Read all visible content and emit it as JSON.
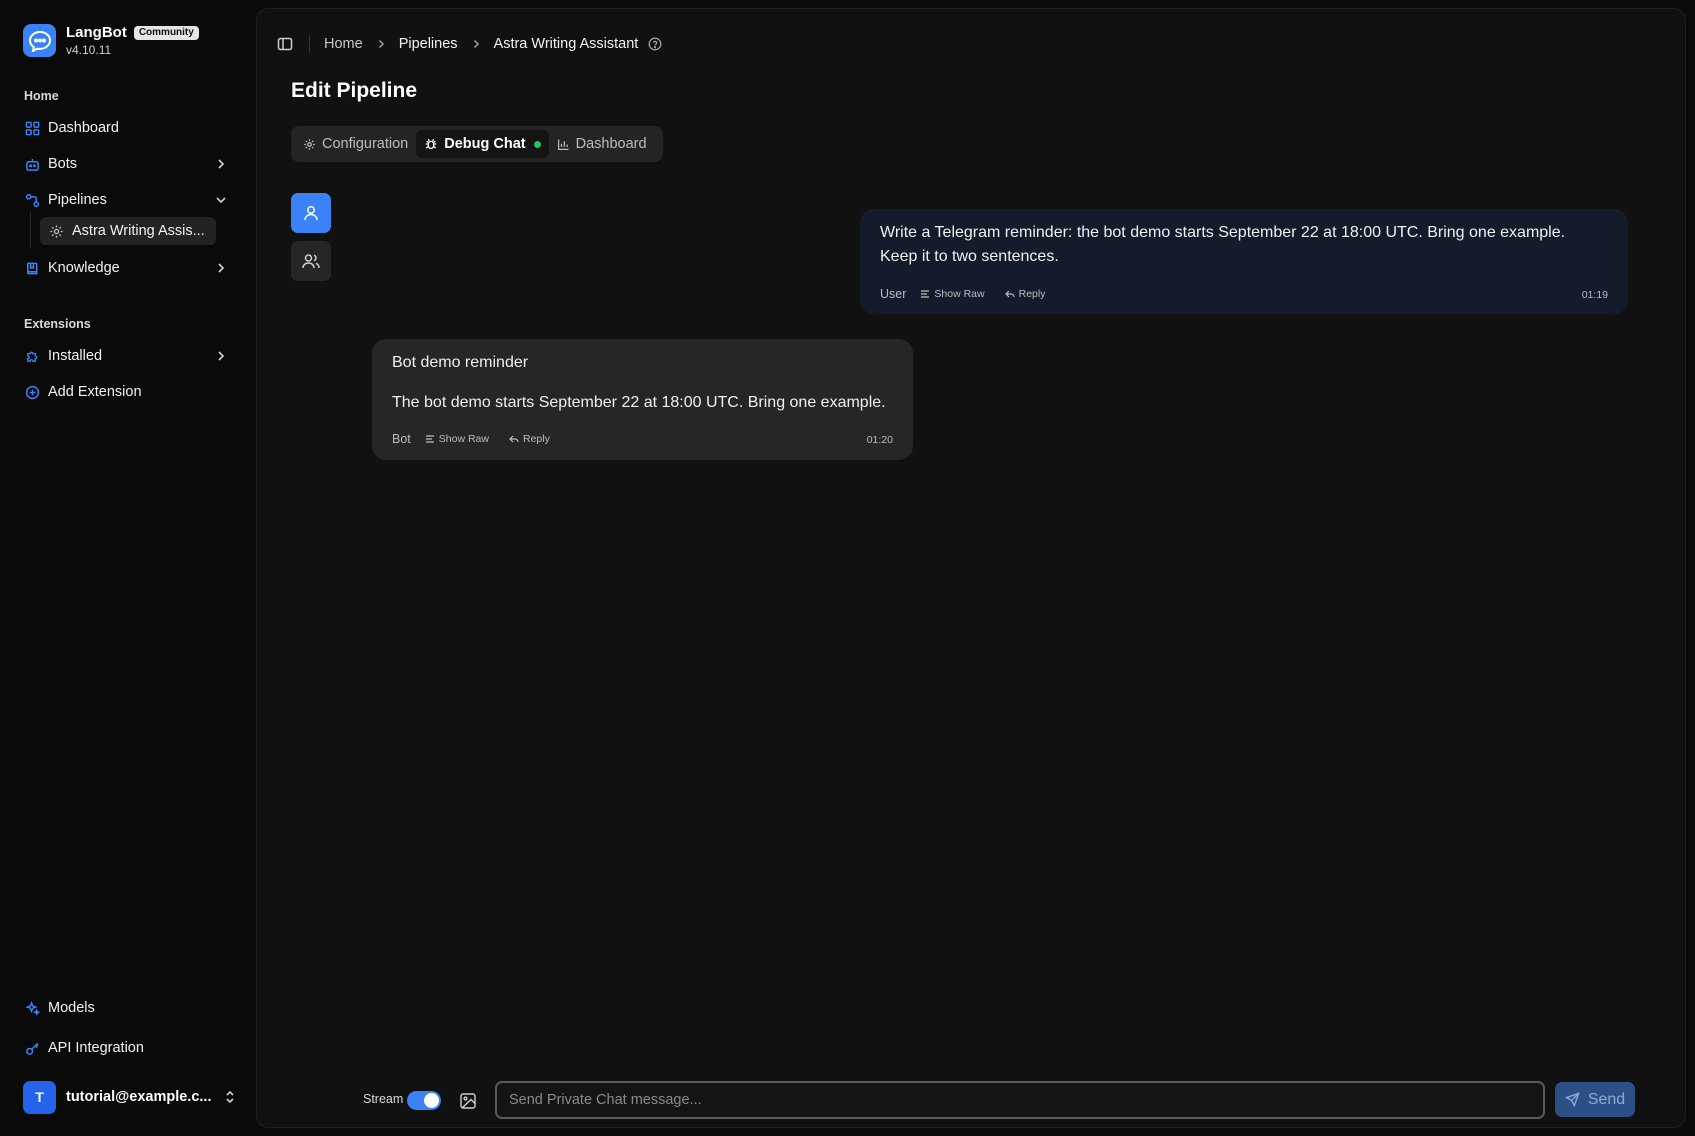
{
  "brand": {
    "name": "LangBot",
    "badge": "Community",
    "version": "v4.10.11"
  },
  "sidebar": {
    "section_home": "Home",
    "section_extensions": "Extensions",
    "items": {
      "dashboard": "Dashboard",
      "bots": "Bots",
      "pipelines": "Pipelines",
      "pipeline_sub": "Astra Writing Assis...",
      "knowledge": "Knowledge",
      "installed": "Installed",
      "add_extension": "Add Extension",
      "models": "Models",
      "api_integration": "API Integration"
    },
    "user": {
      "initial": "T",
      "email": "tutorial@example.c..."
    }
  },
  "breadcrumb": [
    "Home",
    "Pipelines",
    "Astra Writing Assistant"
  ],
  "page_title": "Edit Pipeline",
  "tabs": {
    "configuration": "Configuration",
    "debug_chat": "Debug Chat",
    "dashboard": "Dashboard",
    "active": "debug_chat"
  },
  "messages": {
    "user": {
      "line1": "Write a Telegram reminder: the bot demo starts September 22 at 18:00 UTC. Bring one example.",
      "line2": "Keep it to two sentences.",
      "role": "User",
      "show_raw": "Show Raw",
      "reply": "Reply",
      "time": "01:19"
    },
    "bot": {
      "title": "Bot demo reminder",
      "body": "The bot demo starts September 22 at 18:00 UTC. Bring one example.",
      "role": "Bot",
      "show_raw": "Show Raw",
      "reply": "Reply",
      "time": "01:20"
    }
  },
  "composer": {
    "stream_label": "Stream",
    "stream_enabled": true,
    "placeholder": "Send Private Chat message...",
    "value": "",
    "send_label": "Send"
  },
  "colors": {
    "accent": "#3b82f6",
    "status_dot": "#22c55e",
    "user_bubble": "#141b2b",
    "bot_bubble": "#262626"
  }
}
